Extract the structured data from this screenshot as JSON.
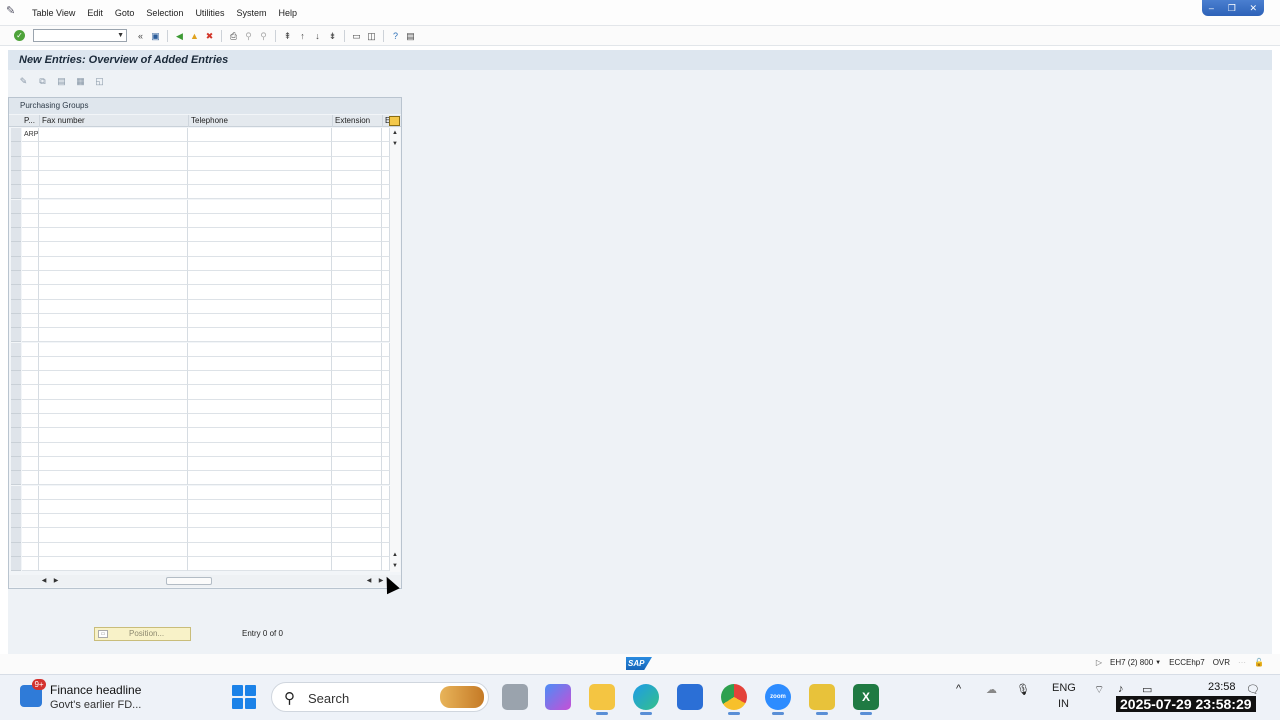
{
  "menubar": {
    "items": [
      "Table View",
      "Edit",
      "Goto",
      "Selection",
      "Utilities",
      "System",
      "Help"
    ]
  },
  "toolbar": {
    "command_field_value": ""
  },
  "page": {
    "title": "New Entries: Overview of Added Entries"
  },
  "table": {
    "title": "Purchasing Groups",
    "columns": [
      "P...",
      "Fax number",
      "Telephone",
      "Extension",
      "E"
    ],
    "rows": [
      {
        "p": "ARP",
        "fax": "",
        "telephone": "",
        "extension": ""
      }
    ],
    "visible_row_count": 31
  },
  "bottom": {
    "position_button": "Position...",
    "entry_info": "Entry 0 of 0"
  },
  "statusbar": {
    "logo": "SAP",
    "system": "EH7 (2) 800",
    "server": "ECCEhp7",
    "mode": "OVR"
  },
  "taskbar": {
    "news_badge": "9+",
    "news_headline": "Finance headline",
    "news_subline": "Govt's earlier FD...",
    "search_label": "Search",
    "lang": "ENG",
    "region": "IN",
    "time": "23:58",
    "timestamp_overlay": "2025-07-29 23:58:29",
    "zoom_label": "zoom"
  }
}
